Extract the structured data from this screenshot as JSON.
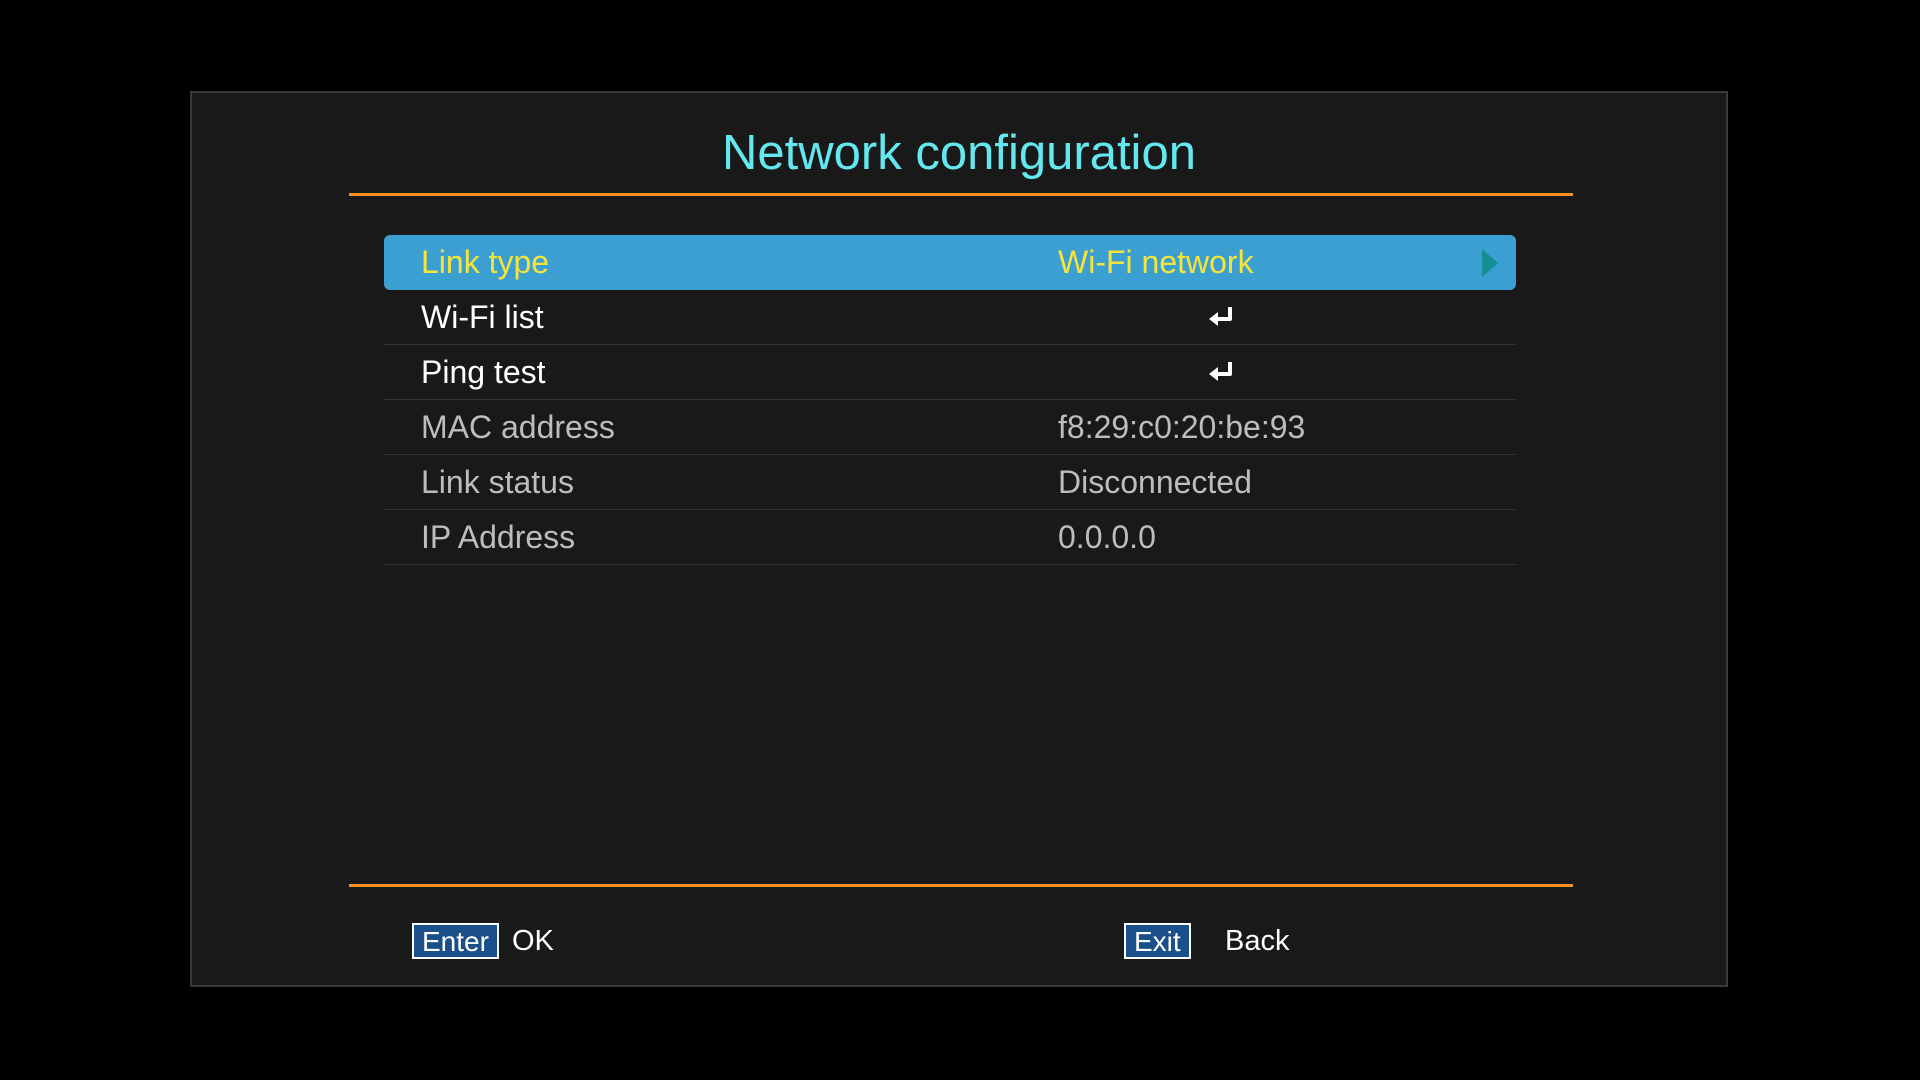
{
  "title": "Network configuration",
  "colors": {
    "title": "#64e8f0",
    "divider": "#f0901e",
    "highlight_bg": "#3b9fd1",
    "highlight_text": "#f6e43a",
    "arrow": "#118f92",
    "key_bg": "#1a4f8a"
  },
  "menu": {
    "items": [
      {
        "label": "Link type",
        "value": "Wi-Fi network",
        "icon": "right-arrow-icon"
      },
      {
        "label": "Wi-Fi list",
        "icon": "enter-return-icon"
      },
      {
        "label": "Ping test",
        "icon": "enter-return-icon"
      },
      {
        "label": "MAC address",
        "value": "f8:29:c0:20:be:93"
      },
      {
        "label": "Link status",
        "value": "Disconnected"
      },
      {
        "label": "IP Address",
        "value": "0.0.0.0"
      }
    ]
  },
  "footer": {
    "enter_key": "Enter",
    "enter_action": "OK",
    "exit_key": "Exit",
    "exit_action": "Back"
  }
}
